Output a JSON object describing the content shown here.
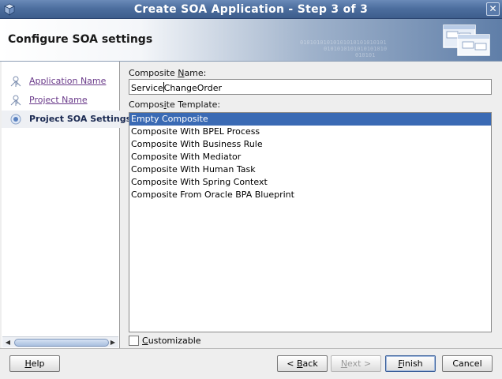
{
  "window": {
    "title": "Create SOA Application - Step 3 of 3",
    "close_glyph": "✕"
  },
  "banner": {
    "heading": "Configure SOA settings",
    "bits_line1": "01010101010101010101010101",
    "bits_line2": "0101010101010101010",
    "bits_line3": "010101"
  },
  "nav": {
    "items": [
      {
        "label": "Application Name",
        "state": "completed"
      },
      {
        "label": "Project Name",
        "state": "completed"
      },
      {
        "label": "Project SOA Settings",
        "state": "current"
      }
    ]
  },
  "form": {
    "composite_name_label_pre": "Composite ",
    "composite_name_label_mnemonic": "N",
    "composite_name_label_post": "ame:",
    "composite_name_value_before_caret": "Service",
    "composite_name_value_after_caret": "ChangeOrder",
    "composite_template_label_pre": "Compos",
    "composite_template_label_mnemonic": "i",
    "composite_template_label_post": "te Template:",
    "templates": [
      "Empty Composite",
      "Composite With BPEL Process",
      "Composite With Business Rule",
      "Composite With Mediator",
      "Composite With Human Task",
      "Composite With Spring Context",
      "Composite From Oracle BPA Blueprint"
    ],
    "selected_template_index": 0,
    "customizable_label_mnemonic": "C",
    "customizable_label_rest": "ustomizable",
    "customizable_checked": false
  },
  "buttons": {
    "help_mnemonic": "H",
    "help_rest": "elp",
    "back_prefix": "< ",
    "back_mnemonic": "B",
    "back_rest": "ack",
    "next_mnemonic": "N",
    "next_rest": "ext >",
    "finish_mnemonic": "F",
    "finish_rest": "inish",
    "cancel": "Cancel"
  },
  "colors": {
    "titlebar": "#4d6f9f",
    "selection": "#3a6ab4",
    "link": "#6a3a8a"
  }
}
